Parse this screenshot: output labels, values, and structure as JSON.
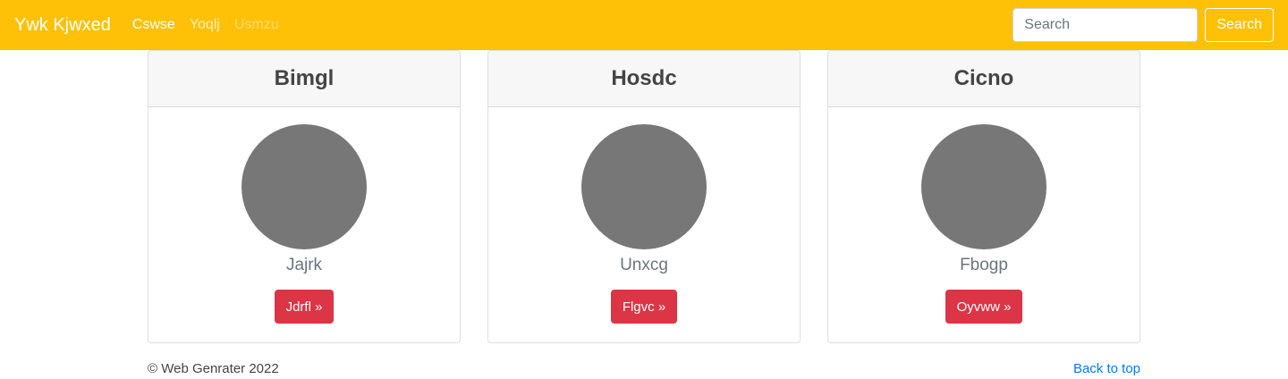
{
  "navbar": {
    "brand": "Ywk Kjwxed",
    "links": [
      "Cswse",
      "Yoqlj",
      "Usmzu"
    ],
    "search_placeholder": "Search",
    "search_button": "Search",
    "bg_color": "#ffc107"
  },
  "cards": [
    {
      "title": "Bimgl",
      "text": "Jajrk",
      "button": "Jdrfl »"
    },
    {
      "title": "Hosdc",
      "text": "Unxcg",
      "button": "Flgvc »"
    },
    {
      "title": "Cicno",
      "text": "Fbogp",
      "button": "Oyvww »"
    }
  ],
  "footer": {
    "copyright": "© Web Genrater 2022",
    "back_to_top": "Back to top"
  },
  "colors": {
    "button": "#dc3545",
    "avatar": "#777777",
    "link": "#007bff"
  }
}
